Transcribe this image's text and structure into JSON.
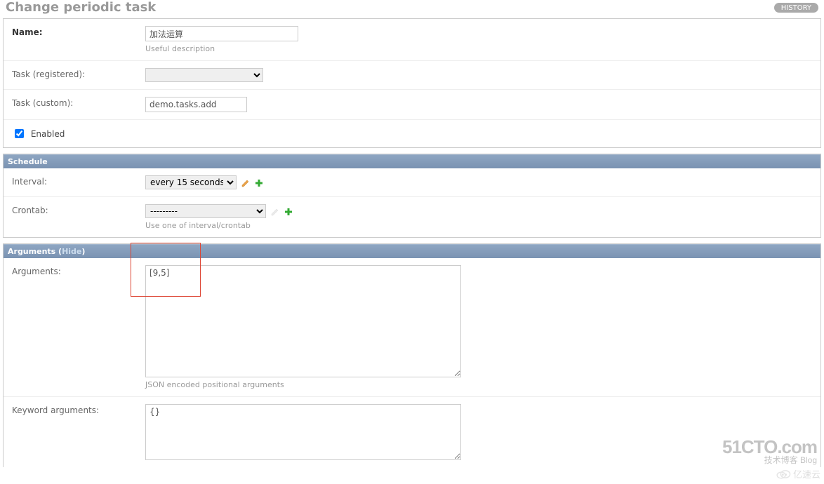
{
  "header": {
    "title": "Change periodic task",
    "history_label": "History"
  },
  "module_basic": {
    "name_label": "Name:",
    "name_value": "加法运算",
    "name_help": "Useful description",
    "task_registered_label": "Task (registered):",
    "task_registered_value": "",
    "task_custom_label": "Task (custom):",
    "task_custom_value": "demo.tasks.add",
    "enabled_label": "Enabled",
    "enabled_checked": true
  },
  "section_schedule": {
    "header": "Schedule",
    "interval_label": "Interval:",
    "interval_value": "every 15 seconds",
    "crontab_label": "Crontab:",
    "crontab_value": "---------",
    "crontab_help": "Use one of interval/crontab"
  },
  "section_arguments": {
    "header_prefix": "Arguments (",
    "header_link": "Hide",
    "header_suffix": ")",
    "args_label": "Arguments:",
    "args_value": "[9,5]",
    "args_help": "JSON encoded positional arguments",
    "kwargs_label": "Keyword arguments:",
    "kwargs_value": "{}"
  },
  "watermarks": {
    "top_line1": "51CTO.com",
    "top_line2": "技术博客  Blog",
    "bottom": "亿速云"
  }
}
